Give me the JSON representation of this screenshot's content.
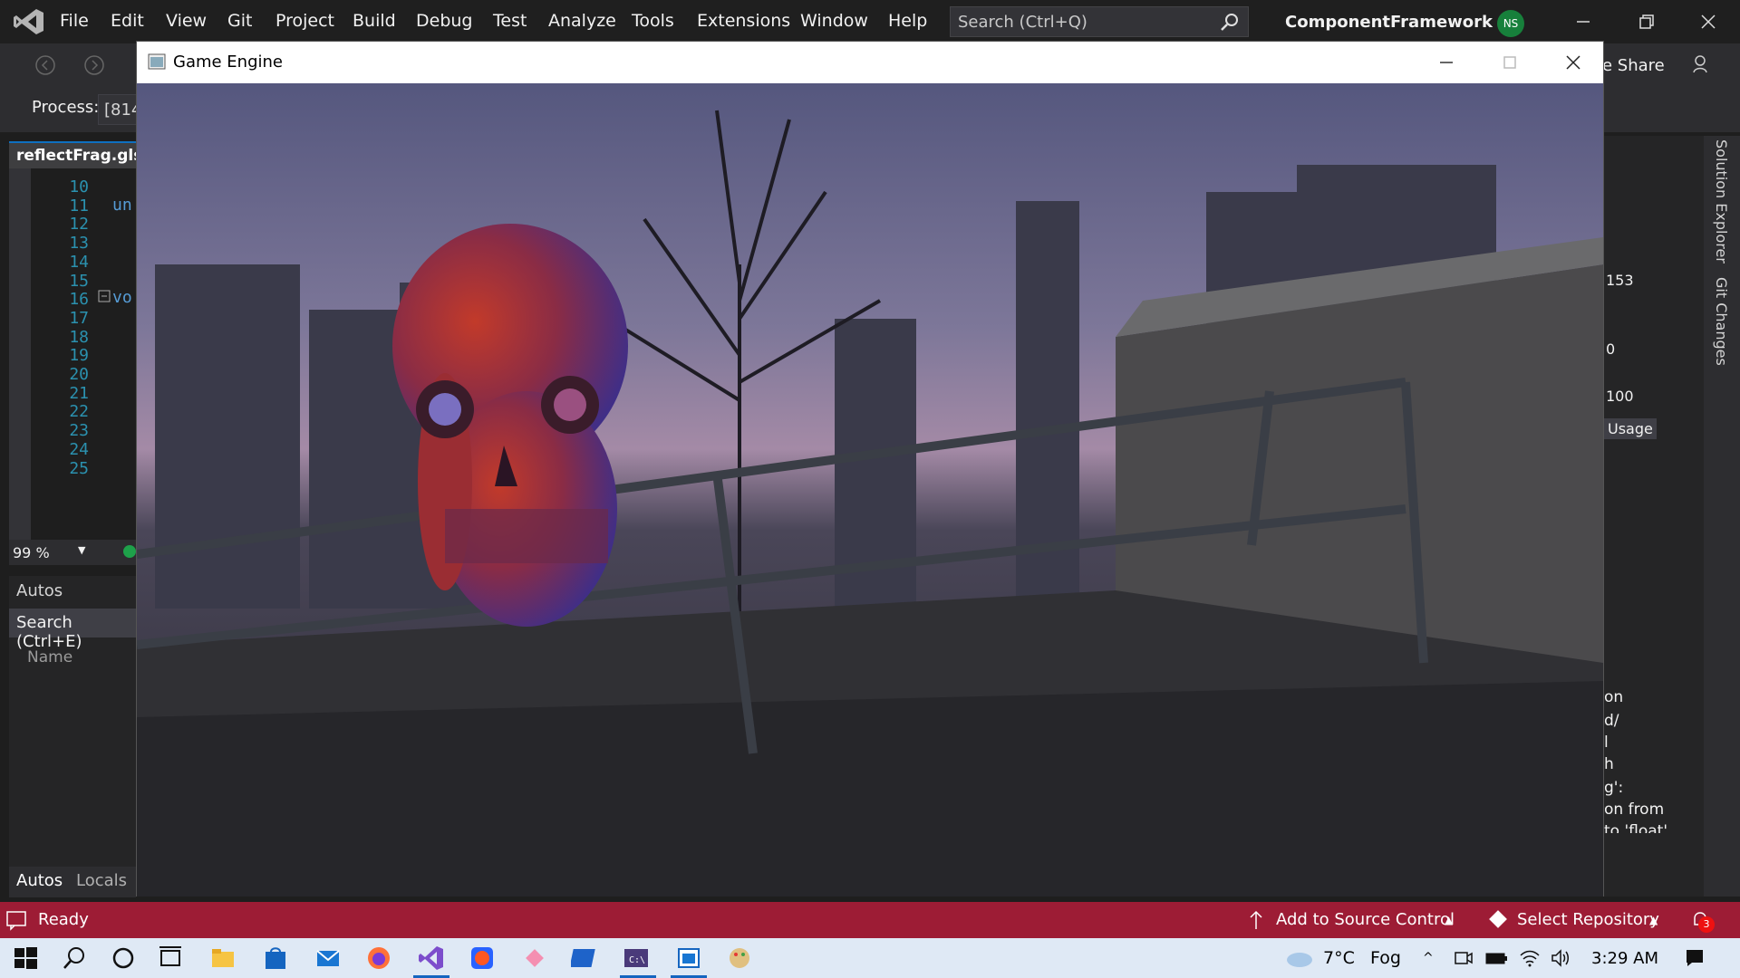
{
  "menubar": {
    "items": [
      "File",
      "Edit",
      "View",
      "Git",
      "Project",
      "Build",
      "Debug",
      "Test",
      "Analyze",
      "Tools",
      "Extensions",
      "Window",
      "Help"
    ],
    "search_placeholder": "Search (Ctrl+Q)",
    "solution_name": "ComponentFramework",
    "avatar_initials": "NS"
  },
  "toolbar": {
    "live_share_label": "e Share"
  },
  "process": {
    "label": "Process:",
    "value": "[814"
  },
  "editor": {
    "tab_title": "reflectFrag.glsl",
    "line_numbers": [
      "10",
      "11",
      "12",
      "13",
      "14",
      "15",
      "16",
      "17",
      "18",
      "19",
      "20",
      "21",
      "22",
      "23",
      "24",
      "25"
    ],
    "code_line_11": "un",
    "code_line_15": "vo",
    "zoom": "99 %"
  },
  "autos": {
    "title": "Autos",
    "search": "Search (Ctrl+E)",
    "column_name": "Name",
    "tabs": [
      "Autos",
      "Locals"
    ]
  },
  "right_panel": {
    "value_153": "153",
    "value_0": "0",
    "value_100": "100",
    "usage_label": "Usage",
    "output_lines": [
      "on",
      "d/",
      "l",
      "h",
      "g':",
      "on from",
      "to 'float'"
    ]
  },
  "right_vertical_tabs": [
    "Solution Explorer",
    "Git Changes"
  ],
  "game_window": {
    "title": "Game Engine"
  },
  "statusbar": {
    "ready": "Ready",
    "add_source_control": "Add to Source Control",
    "select_repository": "Select Repository",
    "notification_count": "3"
  },
  "taskbar": {
    "weather_temp": "7°C",
    "weather_cond": "Fog",
    "time": "3:29 AM"
  },
  "colors": {
    "statusbar": "#9d1c35",
    "taskbar": "#dfe9f5",
    "accent": "#0e70c0"
  }
}
